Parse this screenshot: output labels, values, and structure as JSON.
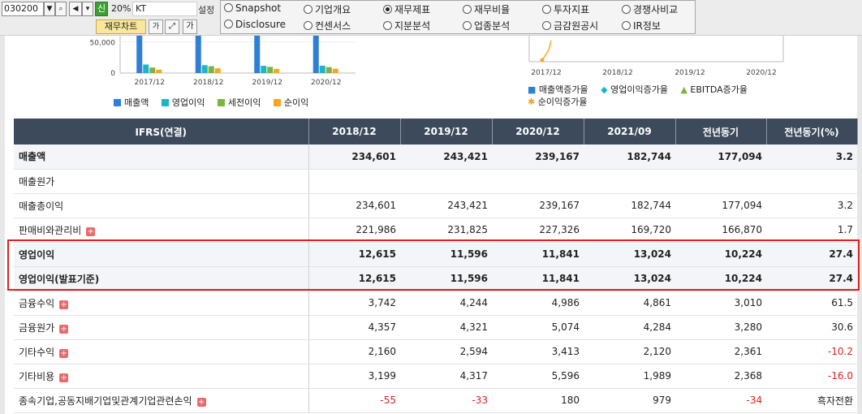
{
  "toolbar": {
    "code": "030200",
    "sin": "신",
    "pct": "20%",
    "name": "KT",
    "setting": "설정",
    "fin_chart": "재무차트",
    "font_small": "가",
    "font_large": "가"
  },
  "radios": [
    {
      "label": "Snapshot",
      "selected": false
    },
    {
      "label": "기업개요",
      "selected": false
    },
    {
      "label": "재무제표",
      "selected": true
    },
    {
      "label": "재무비율",
      "selected": false
    },
    {
      "label": "투자지표",
      "selected": false
    },
    {
      "label": "경쟁사비교",
      "selected": false
    },
    {
      "label": "Disclosure",
      "selected": false
    },
    {
      "label": "컨센서스",
      "selected": false
    },
    {
      "label": "지분분석",
      "selected": false
    },
    {
      "label": "업종분석",
      "selected": false
    },
    {
      "label": "금감원공시",
      "selected": false
    },
    {
      "label": "IR정보",
      "selected": false
    }
  ],
  "chart_data": [
    {
      "type": "bar",
      "categories": [
        "2017/12",
        "2018/12",
        "2019/12",
        "2020/12"
      ],
      "ytick": "50,000",
      "ytick0": "0",
      "series": [
        {
          "name": "매출액",
          "color": "#2f7fd6",
          "values": [
            233387,
            234601,
            243421,
            239167
          ]
        },
        {
          "name": "영업이익",
          "color": "#1fb3c5",
          "values": [
            13753,
            12615,
            11596,
            11841
          ]
        },
        {
          "name": "세전이익",
          "color": "#7cb342",
          "values": [
            8905,
            11101,
            9950,
            9622
          ]
        },
        {
          "name": "순이익",
          "color": "#f5a623",
          "values": [
            5571,
            7638,
            6697,
            7039
          ]
        }
      ]
    },
    {
      "type": "line",
      "categories": [
        "2017/12",
        "2018/12",
        "2019/12",
        "2020/12"
      ],
      "series": [
        {
          "name": "매출액증가율",
          "color": "#2f7fd6"
        },
        {
          "name": "영업이익증가율",
          "color": "#1fb3c5"
        },
        {
          "name": "EBITDA증가율",
          "color": "#7cb342"
        },
        {
          "name": "순이익증가율",
          "color": "#f5a623"
        }
      ]
    }
  ],
  "table": {
    "headers": [
      "IFRS(연결)",
      "2018/12",
      "2019/12",
      "2020/12",
      "2021/09",
      "전년동기",
      "전년동기(%)"
    ],
    "rows": [
      {
        "label": "매출액",
        "bold": true,
        "shade": true,
        "plus": false,
        "cells": [
          "234,601",
          "243,421",
          "239,167",
          "182,744",
          "177,094",
          "3.2"
        ]
      },
      {
        "label": "매출원가",
        "bold": false,
        "shade": false,
        "plus": false,
        "cells": [
          "",
          "",
          "",
          "",
          "",
          ""
        ]
      },
      {
        "label": "매출총이익",
        "bold": false,
        "shade": false,
        "plus": false,
        "cells": [
          "234,601",
          "243,421",
          "239,167",
          "182,744",
          "177,094",
          "3.2"
        ]
      },
      {
        "label": "판매비와관리비",
        "bold": false,
        "shade": false,
        "plus": true,
        "cells": [
          "221,986",
          "231,825",
          "227,326",
          "169,720",
          "166,870",
          "1.7"
        ]
      },
      {
        "label": "영업이익",
        "bold": true,
        "shade": true,
        "plus": false,
        "cells": [
          "12,615",
          "11,596",
          "11,841",
          "13,024",
          "10,224",
          "27.4"
        ]
      },
      {
        "label": "영업이익(발표기준)",
        "bold": true,
        "shade": true,
        "plus": false,
        "cells": [
          "12,615",
          "11,596",
          "11,841",
          "13,024",
          "10,224",
          "27.4"
        ]
      },
      {
        "label": "금융수익",
        "bold": false,
        "shade": false,
        "plus": true,
        "cells": [
          "3,742",
          "4,244",
          "4,986",
          "4,861",
          "3,010",
          "61.5"
        ]
      },
      {
        "label": "금융원가",
        "bold": false,
        "shade": false,
        "plus": true,
        "cells": [
          "4,357",
          "4,321",
          "5,074",
          "4,284",
          "3,280",
          "30.6"
        ]
      },
      {
        "label": "기타수익",
        "bold": false,
        "shade": false,
        "plus": true,
        "cells": [
          "2,160",
          "2,594",
          "3,413",
          "2,120",
          "2,361",
          "-10.2"
        ]
      },
      {
        "label": "기타비용",
        "bold": false,
        "shade": false,
        "plus": true,
        "cells": [
          "3,199",
          "4,317",
          "5,596",
          "1,989",
          "2,368",
          "-16.0"
        ]
      },
      {
        "label": "종속기업,공동지배기업및관계기업관련손익",
        "bold": false,
        "shade": false,
        "plus": true,
        "cells": [
          "-55",
          "-33",
          "180",
          "979",
          "-34",
          "흑자전환"
        ]
      }
    ]
  }
}
